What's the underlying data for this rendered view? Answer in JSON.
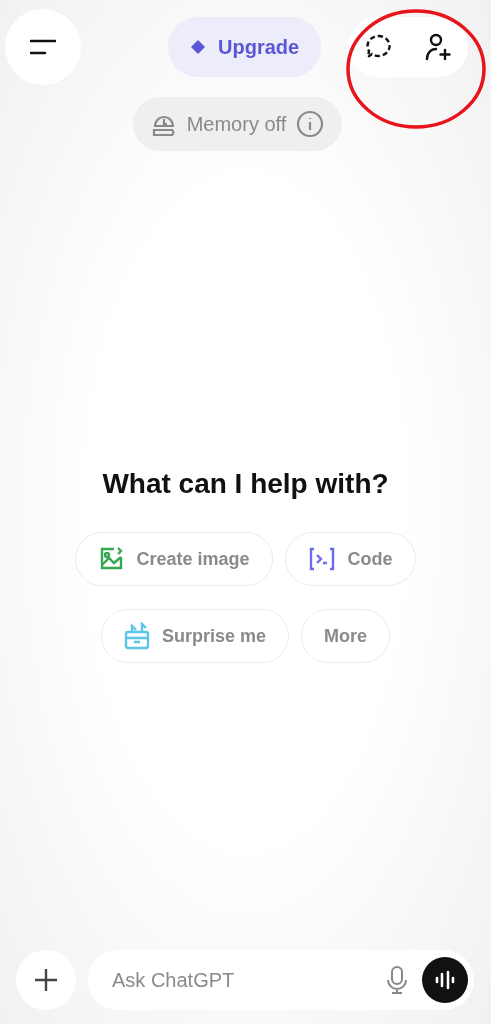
{
  "header": {
    "upgrade": "Upgrade",
    "memory": "Memory off"
  },
  "heading": "What can I help with?",
  "suggestions": [
    {
      "label": "Create image",
      "kind": "image",
      "color": "#34a853"
    },
    {
      "label": "Code",
      "kind": "code",
      "color": "#6c6cf0"
    },
    {
      "label": "Surprise me",
      "kind": "gift",
      "color": "#5cc4e6"
    },
    {
      "label": "More",
      "kind": "plain"
    }
  ],
  "composer": {
    "placeholder": "Ask ChatGPT"
  },
  "annotation": {
    "kind": "circle",
    "color": "#e8141b"
  }
}
